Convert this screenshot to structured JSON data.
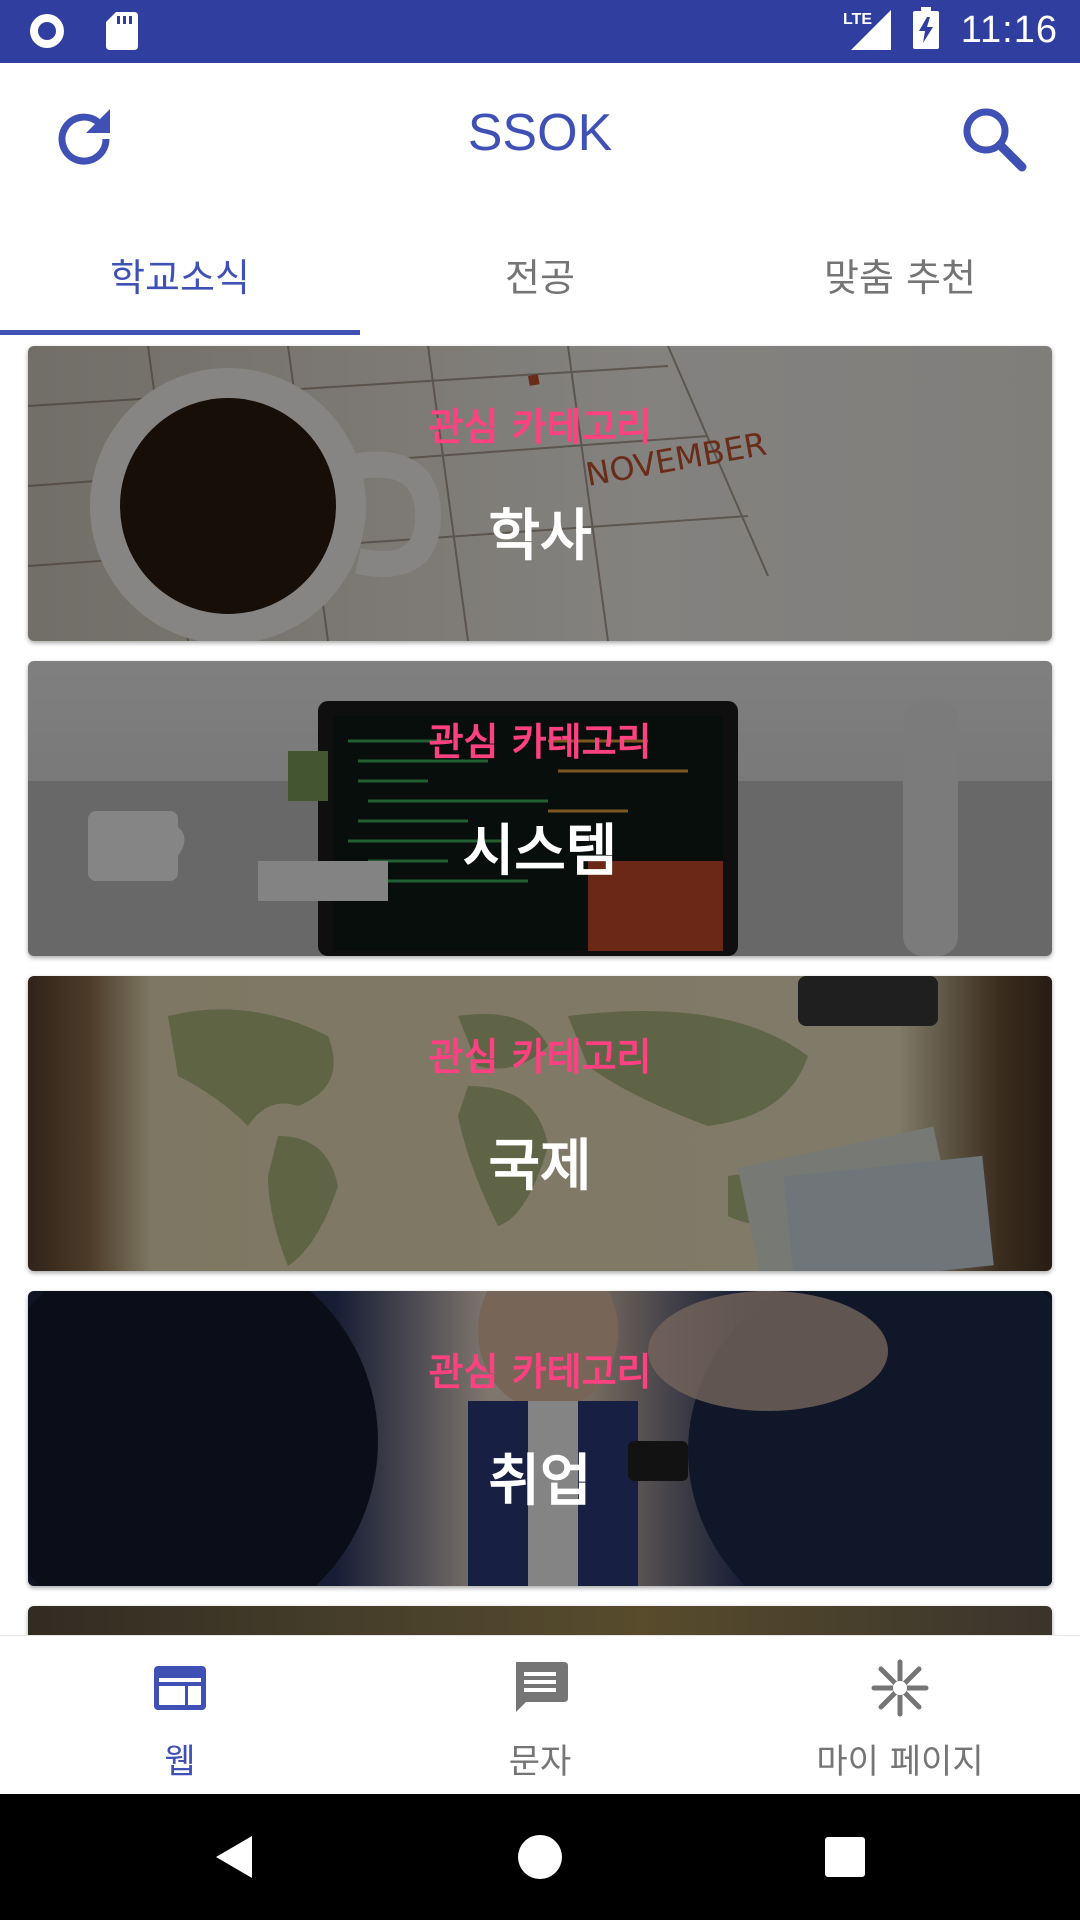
{
  "status_bar": {
    "time": "11:16",
    "network": "LTE",
    "icons": [
      "record-icon",
      "sd-card-icon",
      "signal-icon",
      "battery-charging-icon"
    ]
  },
  "app_bar": {
    "title": "SSOK",
    "left_icon": "refresh-icon",
    "right_icon": "search-icon",
    "color": "#3f51b5"
  },
  "tabs": [
    {
      "label": "학교소식",
      "active": true
    },
    {
      "label": "전공",
      "active": false
    },
    {
      "label": "맞춤 추천",
      "active": false
    }
  ],
  "cards": [
    {
      "subtitle": "관심 카테고리",
      "title": "학사",
      "image": "coffee-calendar-photo"
    },
    {
      "subtitle": "관심 카테고리",
      "title": "시스템",
      "image": "laptop-code-photo"
    },
    {
      "subtitle": "관심 카테고리",
      "title": "국제",
      "image": "world-map-photo"
    },
    {
      "subtitle": "관심 카테고리",
      "title": "취업",
      "image": "business-meeting-photo"
    }
  ],
  "bottom_nav": [
    {
      "label": "웹",
      "icon": "web-icon",
      "active": true
    },
    {
      "label": "문자",
      "icon": "message-icon",
      "active": false
    },
    {
      "label": "마이 페이지",
      "icon": "asterisk-icon",
      "active": false
    }
  ],
  "colors": {
    "primary": "#3f51b5",
    "primary_dark": "#303f9f",
    "accent": "#ff4081"
  }
}
